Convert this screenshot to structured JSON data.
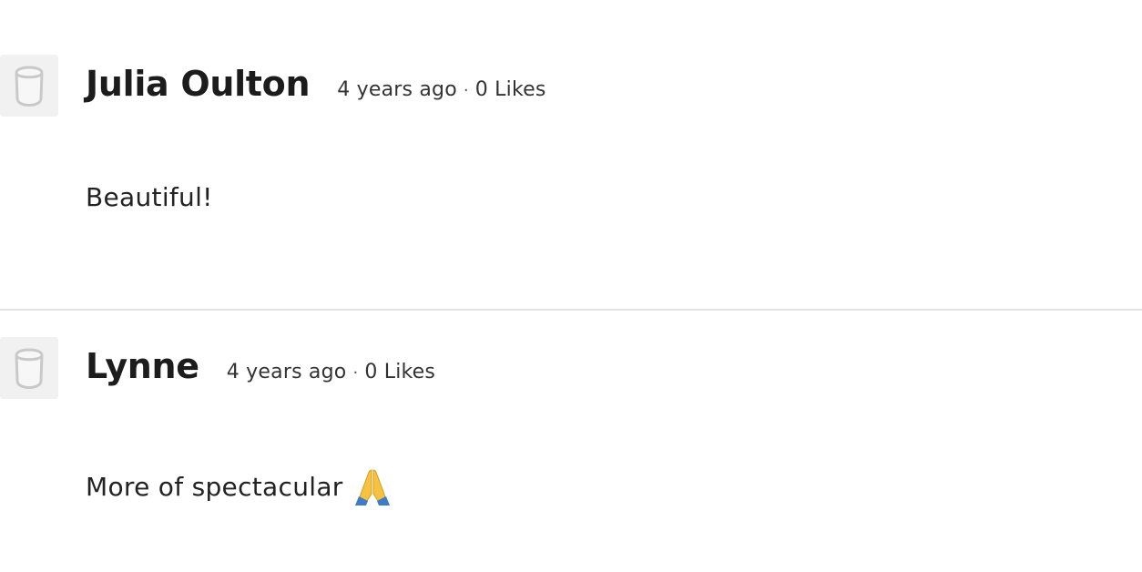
{
  "comments": [
    {
      "author": "Julia Oulton",
      "timestamp": "4 years ago",
      "separator": "·",
      "likes": "0 Likes",
      "body": "Beautiful!",
      "avatar_icon": "default-avatar-icon"
    },
    {
      "author": "Lynne",
      "timestamp": "4 years ago",
      "separator": "·",
      "likes": "0 Likes",
      "body": "More of spectacular",
      "emoji_icon": "folded-hands-icon",
      "avatar_icon": "default-avatar-icon"
    }
  ],
  "colors": {
    "divider": "#e2e2e2",
    "avatar_bg": "#f1f1f1",
    "avatar_stroke": "#c9c9c9",
    "text": "#1f1f1f",
    "emoji_skin": "#f5c242",
    "emoji_sleeve": "#3f7cc8"
  }
}
